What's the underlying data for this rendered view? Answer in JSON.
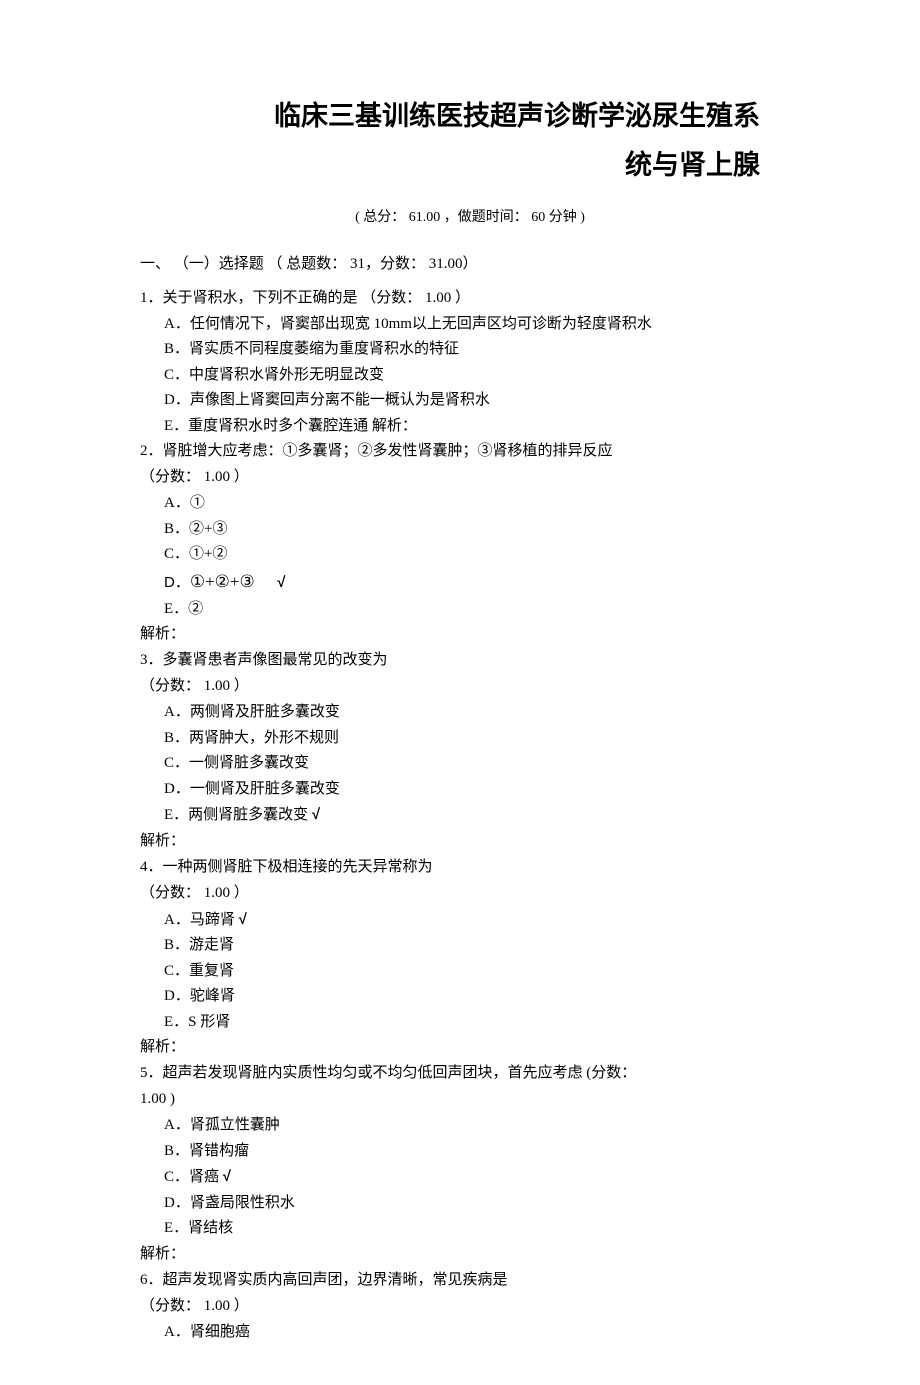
{
  "title_line1": "临床三基训练医技超声诊断学泌尿生殖系",
  "title_line2": "统与肾上腺",
  "meta": "( 总分：  61.00 ，做题时间：  60 分钟  )",
  "section_header": "一、 （一）选择题 （ 总题数：  31，分数：  31.00）",
  "questions": [
    {
      "q": "1．关于肾积水，下列不正确的是 （分数：  1.00 ）",
      "opts": [
        "A．任何情况下，肾窦部出现宽   10mm以上无回声区均可诊断为轻度肾积水",
        "B．肾实质不同程度萎缩为重度肾积水的特征",
        "C．中度肾积水肾外形无明显改变",
        "D．声像图上肾窦回声分离不能一概认为是肾积水",
        "E．重度肾积水时多个囊腔连通  解析："
      ],
      "score": "",
      "explain": ""
    },
    {
      "q": "2．肾脏增大应考虑：①多囊肾；②多发性肾囊肿；③肾移植的排异反应",
      "score": "（分数：  1.00 ）",
      "opts": [
        "A．①",
        "B．②+③",
        "C．①+②",
        "D．①+②+③       √",
        "E．②"
      ],
      "explain": "解析："
    },
    {
      "q": "3．多囊肾患者声像图最常见的改变为",
      "score": "（分数：  1.00 ）",
      "opts": [
        "A．两侧肾及肝脏多囊改变",
        "B．两肾肿大，外形不规则",
        "C．一侧肾脏多囊改变",
        "D．一侧肾及肝脏多囊改变",
        "E．两侧肾脏多囊改变 √"
      ],
      "explain": "解析："
    },
    {
      "q": "4．一种两侧肾脏下极相连接的先天异常称为",
      "score": "（分数：  1.00 ）",
      "opts": [
        "A．马蹄肾  √",
        "B．游走肾",
        "C．重复肾",
        "D．驼峰肾",
        "E．S 形肾"
      ],
      "explain": "解析："
    },
    {
      "q": "5．超声若发现肾脏内实质性均匀或不均匀低回声团块，首先应考虑    (分数：",
      "score": "1.00 )",
      "opts": [
        "A．肾孤立性囊肿",
        "B．肾错构瘤",
        "C．肾癌  √",
        "D．肾盏局限性积水",
        "E．肾结核"
      ],
      "explain": "解析："
    },
    {
      "q": "6．超声发现肾实质内高回声团，边界清晰，常见疾病是",
      "score": "（分数：  1.00 ）",
      "opts": [
        "A．肾细胞癌"
      ],
      "explain": ""
    }
  ]
}
